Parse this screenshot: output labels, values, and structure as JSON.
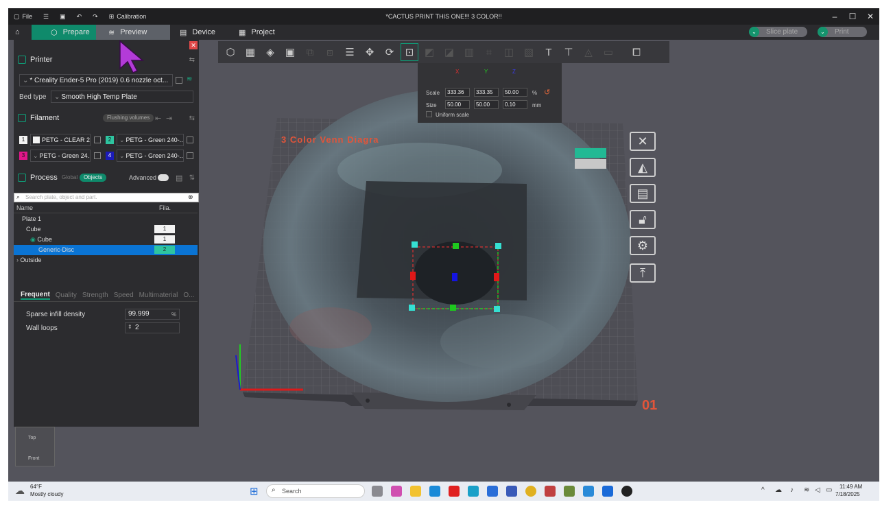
{
  "titlebar": {
    "file_label": "File",
    "calibration_label": "Calibration",
    "window_title": "*CACTUS PRINT THIS ONE!!! 3 COLOR!!"
  },
  "tabs": {
    "prepare": "Prepare",
    "preview": "Preview",
    "device": "Device",
    "project": "Project",
    "slice_plate": "Slice plate",
    "print": "Print"
  },
  "printer": {
    "section_title": "Printer",
    "printer_name": "* Creality Ender-5 Pro (2019) 0.6 nozzle oct...",
    "bed_type_label": "Bed type",
    "bed_type_value": "Smooth High Temp Plate"
  },
  "filament": {
    "section_title": "Filament",
    "flushing_label": "Flushing volumes",
    "items": [
      {
        "num": "1",
        "name": "PETG - CLEAR 2...",
        "color": "#f2f2f2"
      },
      {
        "num": "2",
        "name": "PETG - Green 240-...",
        "color": "#2ec4a0"
      },
      {
        "num": "3",
        "name": "PETG - Green 24...",
        "color": "#e0168a"
      },
      {
        "num": "4",
        "name": "PETG - Green 240-...",
        "color": "#1b1bb8"
      }
    ]
  },
  "process": {
    "section_title": "Process",
    "global_label": "Global",
    "objects_label": "Objects",
    "advanced_label": "Advanced",
    "search_placeholder": "Search plate, object and part.",
    "col_name": "Name",
    "col_fila": "Fila.",
    "tree": [
      {
        "label": "Plate 1",
        "fila": ""
      },
      {
        "label": "Cube",
        "fila": "1"
      },
      {
        "label": "Cube",
        "fila": "1"
      },
      {
        "label": "Generic-Disc",
        "fila": "2"
      },
      {
        "label": "Outside",
        "fila": ""
      }
    ]
  },
  "settings_tabs": [
    "Frequent",
    "Quality",
    "Strength",
    "Speed",
    "Multimaterial",
    "O..."
  ],
  "settings": {
    "sparse_label": "Sparse infill density",
    "sparse_value": "99.999",
    "sparse_unit": "%",
    "wall_label": "Wall loops",
    "wall_value": "2"
  },
  "scale_panel": {
    "axis_x": "X",
    "axis_y": "Y",
    "axis_z": "Z",
    "scale_label": "Scale",
    "scale_x": "333.36",
    "scale_y": "333.35",
    "scale_z": "50.00",
    "scale_unit": "%",
    "size_label": "Size",
    "size_x": "50.00",
    "size_y": "50.00",
    "size_z": "0.10",
    "size_unit": "mm",
    "uniform_label": "Uniform scale"
  },
  "viewport": {
    "bed_title": "3 Color Venn Diagra",
    "plate_number": "01",
    "navcube_top": "Top",
    "navcube_front": "Front"
  },
  "taskbar": {
    "weather_temp": "64°F",
    "weather_desc": "Mostly cloudy",
    "search_placeholder": "Search",
    "time": "11:49 AM",
    "date": "7/18/2025"
  }
}
